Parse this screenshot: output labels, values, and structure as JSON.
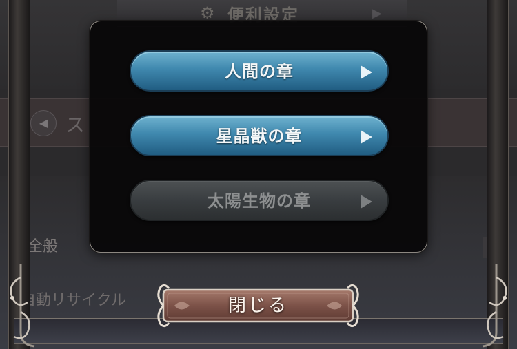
{
  "background": {
    "title": "便利設定",
    "band_text": "ス",
    "section_general": "全般",
    "section_auto_recycle": "自動リサイクル"
  },
  "icons": {
    "gear": "gear-icon",
    "play": "play-triangle-icon",
    "back": "left-arrow-icon"
  },
  "modal": {
    "chapters": [
      {
        "label": "人間の章",
        "enabled": true
      },
      {
        "label": "星晶獣の章",
        "enabled": true
      },
      {
        "label": "太陽生物の章",
        "enabled": false
      }
    ]
  },
  "close_button": {
    "label": "閉じる"
  },
  "colors": {
    "enabled_button": "#3f88ae",
    "disabled_button": "#393d40",
    "close_button": "#8a5f53"
  }
}
